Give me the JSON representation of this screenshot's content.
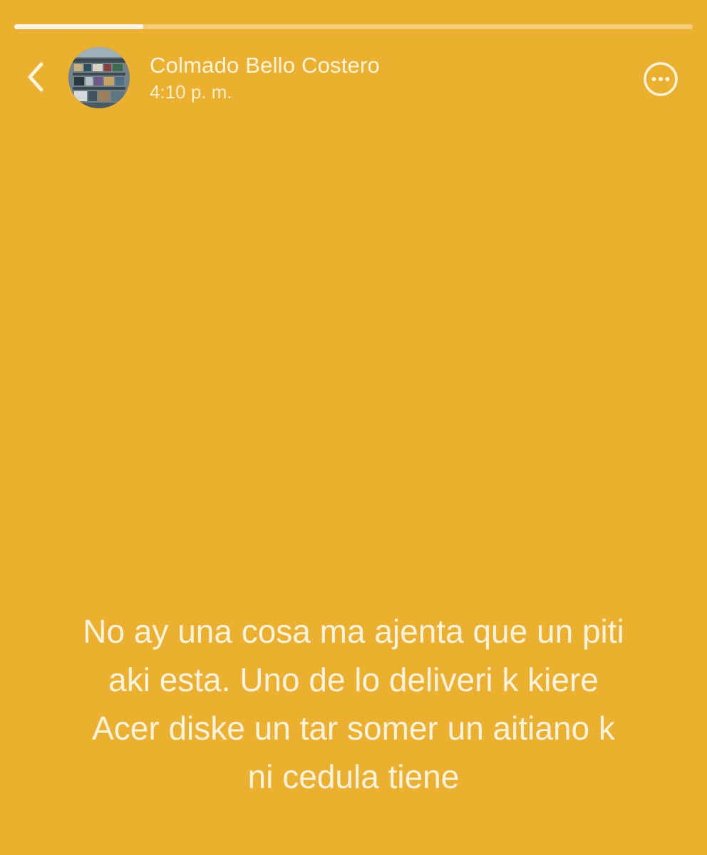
{
  "theme": {
    "background": "#ecb02f",
    "text": "#fdf4df"
  },
  "story": {
    "progress": 0.19,
    "post_text": "No ay una cosa ma ajenta que un piti\naki esta. Uno de lo deliveri k kiere\nAcer diske un tar somer un aitiano k\nni cedula tiene"
  },
  "header": {
    "back_icon": "chevron-left-icon",
    "account_name": "Colmado Bello Costero",
    "timestamp": "4:10 p. m.",
    "more_icon": "more-options-icon"
  }
}
